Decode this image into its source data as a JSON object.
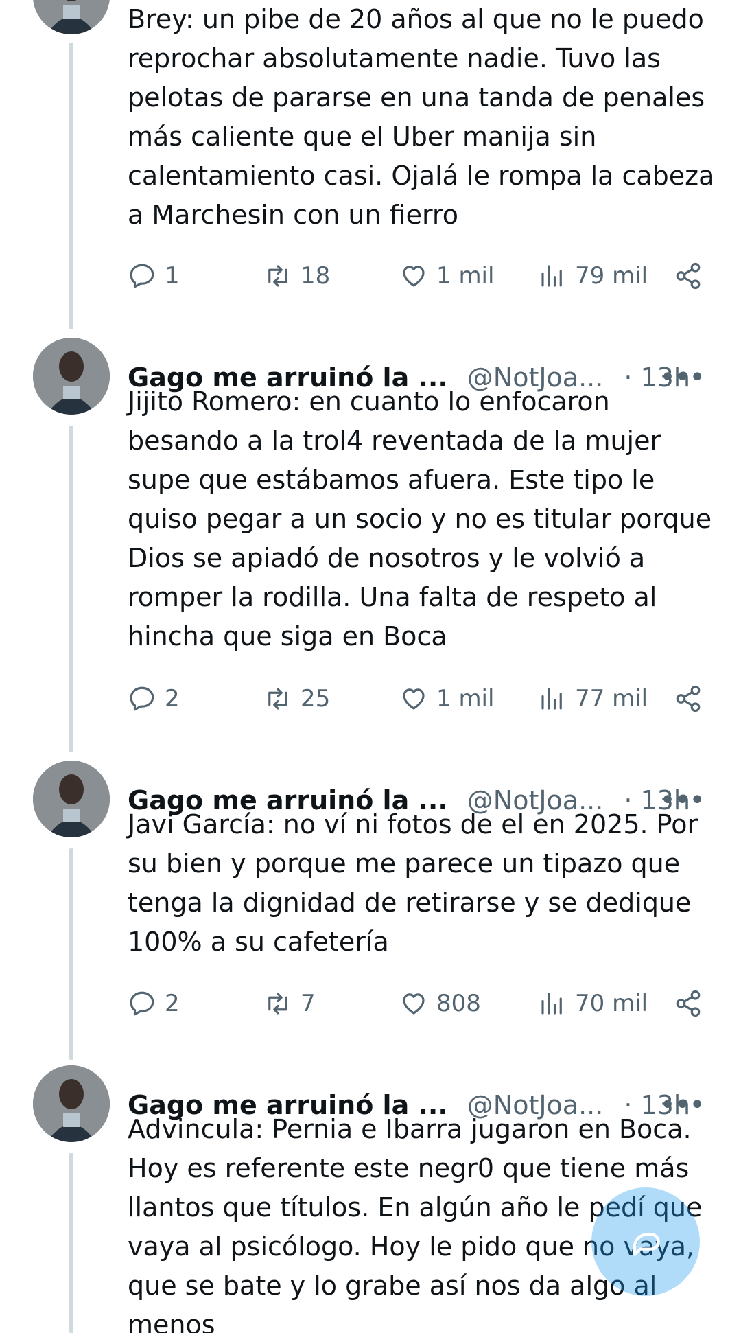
{
  "tweets": [
    {
      "text": "Brey: un pibe de 20 años al que no le puedo reprochar absolutamente nadie. Tuvo las pelotas de pararse en una tanda de penales más caliente que el Uber manija sin calentamiento casi. Ojalá le rompa la cabeza a Marchesin con un fierro",
      "replies": "1",
      "retweets": "18",
      "likes": "1 mil",
      "views": "79 mil"
    },
    {
      "name": "Gago me arruinó la ...",
      "handle": "@NotJoa...",
      "time": "· 13h",
      "text": "Jijito Romero: en cuanto lo enfocaron besando a la trol4 reventada de la mujer supe que estábamos afuera. Este tipo le quiso pegar a un socio y no es titular porque Dios se apiadó de nosotros y le volvió a romper la rodilla. Una falta de respeto al hincha que siga en Boca",
      "replies": "2",
      "retweets": "25",
      "likes": "1 mil",
      "views": "77 mil"
    },
    {
      "name": "Gago me arruinó la ...",
      "handle": "@NotJoa...",
      "time": "· 13h",
      "text": "Javi García: no ví ni fotos de el en 2025. Por su bien y porque me parece un tipazo que tenga la dignidad de retirarse y se dedique 100% a su cafetería",
      "replies": "2",
      "retweets": "7",
      "likes": "808",
      "views": "70 mil"
    },
    {
      "name": "Gago me arruinó la ...",
      "handle": "@NotJoa...",
      "time": "· 13h",
      "text": "Advincula: Pernia e Ibarra jugaron en Boca. Hoy es referente este negr0 que tiene más llantos que títulos. En algún año le pedí que vaya al psicólogo. Hoy le pido que no vaya, que se bate y lo grabe así nos da algo al menos"
    }
  ],
  "more_icon": "more-horizontal-icon",
  "fab_icon": "compose-icon",
  "colors": {
    "accent": "#1d9bf0",
    "muted": "#536471",
    "thread_line": "#cfd9de"
  }
}
